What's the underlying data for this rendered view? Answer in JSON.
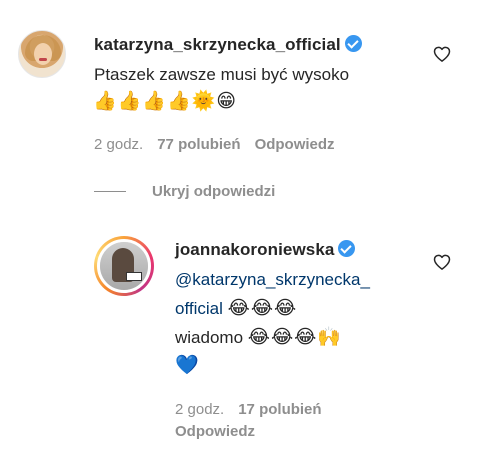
{
  "comment": {
    "username": "katarzyna_skrzynecka_official",
    "text": "Ptaszek zawsze musi być wysoko",
    "emojis": "👍👍👍👍🌞😁",
    "time": "2 godz.",
    "likes": "77 polubień",
    "reply_label": "Odpowiedz"
  },
  "replies_toggle": {
    "label": "Ukryj odpowiedzi"
  },
  "reply": {
    "username": "joannakoroniewska",
    "mention_part1": "@katarzyna_skrzynecka_",
    "mention_part2": "official",
    "emojis_line1": "😂😂😂",
    "text_line2": "wiadomo",
    "emojis_line2": "😂😂😂🙌",
    "emojis_line3": "💙",
    "time": "2 godz.",
    "likes": "17 polubień",
    "reply_label": "Odpowiedz"
  },
  "colors": {
    "verified": "#3897f0",
    "mention": "#00376b",
    "meta": "#8e8e8e"
  },
  "icons": [
    "verified-badge-icon",
    "heart-icon"
  ]
}
